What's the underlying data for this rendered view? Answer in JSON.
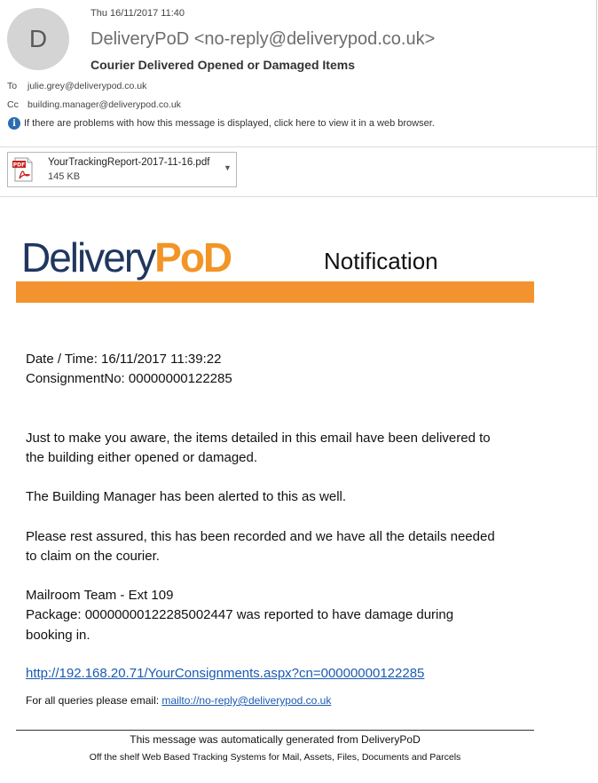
{
  "header": {
    "avatar_letter": "D",
    "date": "Thu 16/11/2017 11:40",
    "sender": "DeliveryPoD <no-reply@deliverypod.co.uk>",
    "subject": "Courier Delivered Opened or Damaged Items",
    "to_label": "To",
    "to_value": "julie.grey@deliverypod.co.uk",
    "cc_label": "Cc",
    "cc_value": "building.manager@deliverypod.co.uk",
    "info_icon": "info-icon",
    "info_text": "If there are problems with how this message is displayed, click here to view it in a web browser."
  },
  "attachment": {
    "icon": "pdf-file-icon",
    "icon_label": "PDF",
    "name": "YourTrackingReport-2017-11-16.pdf",
    "size": "145 KB",
    "caret_icon": "chevron-down-icon"
  },
  "banner": {
    "logo_part1": "Delivery",
    "logo_part2": "PoD",
    "title": "Notification",
    "accent_color": "#f39330",
    "brand_color": "#1f3760"
  },
  "email_body": {
    "date_time": "Date / Time: 16/11/2017 11:39:22",
    "consignment": "ConsignmentNo: 00000000122285",
    "para1_line1": "Just to make you aware, the items detailed in this email have been delivered to",
    "para1_line2": "the building either opened or damaged.",
    "para2": "The Building Manager has been alerted to this as well.",
    "para3_line1": "Please rest assured, this has been recorded and we have all the details needed",
    "para3_line2": "to claim on the courier.",
    "team": "Mailroom Team - Ext 109",
    "package_line1": "Package: 00000000122285002447 was reported to have damage during",
    "package_line2": "booking in.",
    "link": "http://192.168.20.71/YourConsignments.aspx?cn=00000000122285",
    "queries_label": "For all queries please email: ",
    "queries_link": "mailto://no-reply@deliverypod.co.uk"
  },
  "footer": {
    "line1": "This message was automatically generated from DeliveryPoD",
    "line2": "Off the shelf Web Based Tracking Systems for Mail, Assets, Files, Documents and Parcels"
  }
}
